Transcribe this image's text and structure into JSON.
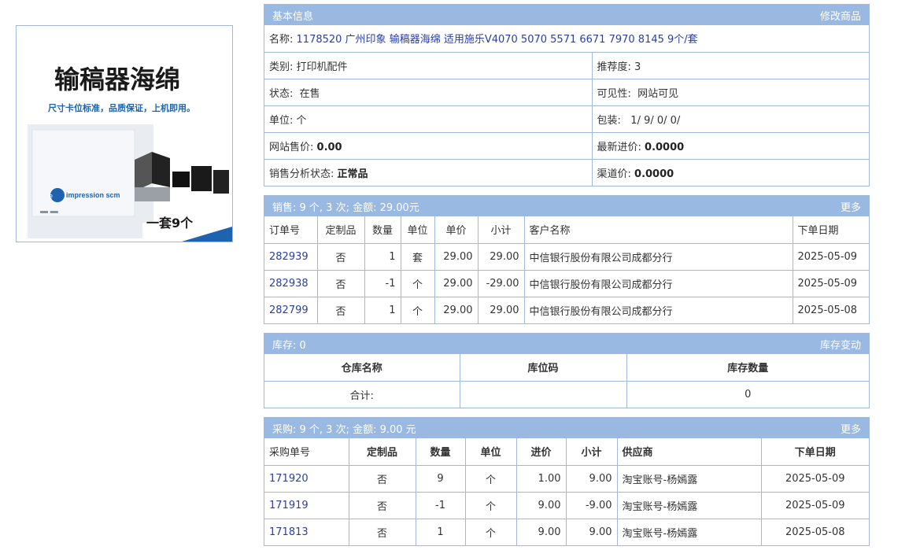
{
  "image": {
    "title": "输稿器海绵",
    "subtitle": "尺寸卡位标准，品质保证，上机即用。",
    "brand": "impression scm",
    "footer": "一套9个"
  },
  "basic": {
    "header": "基本信息",
    "action": "修改商品",
    "name_label": "名称:",
    "name_value": "1178520 广州印象 输稿器海绵 适用施乐V4070 5070 5571 6671 7970 8145 9个/套",
    "category_label": "类别:",
    "category_value": "打印机配件",
    "recommend_label": "推荐度:",
    "recommend_value": "3",
    "status_label": "状态:",
    "status_value": "在售",
    "visibility_label": "可见性:",
    "visibility_value": "网站可见",
    "unit_label": "单位:",
    "unit_value": "个",
    "pack_label": "包装:",
    "pack_value": "1/ 9/ 0/ 0/",
    "web_price_label": "网站售价:",
    "web_price_value": "0.00",
    "latest_cost_label": "最新进价:",
    "latest_cost_value": "0.0000",
    "analysis_label": "销售分析状态:",
    "analysis_value": "正常品",
    "channel_label": "渠道价:",
    "channel_value": "0.0000"
  },
  "sales": {
    "header": "销售: 9 个, 3 次; 金额: 29.00元",
    "more": "更多",
    "columns": [
      "订单号",
      "定制品",
      "数量",
      "单位",
      "单价",
      "小计",
      "客户名称",
      "下单日期"
    ],
    "rows": [
      {
        "id": "282939",
        "custom": "否",
        "qty": "1",
        "unit": "套",
        "price": "29.00",
        "subtotal": "29.00",
        "customer": "中信银行股份有限公司成都分行",
        "date": "2025-05-09"
      },
      {
        "id": "282938",
        "custom": "否",
        "qty": "-1",
        "unit": "个",
        "price": "29.00",
        "subtotal": "-29.00",
        "customer": "中信银行股份有限公司成都分行",
        "date": "2025-05-09"
      },
      {
        "id": "282799",
        "custom": "否",
        "qty": "1",
        "unit": "个",
        "price": "29.00",
        "subtotal": "29.00",
        "customer": "中信银行股份有限公司成都分行",
        "date": "2025-05-08"
      }
    ]
  },
  "stock": {
    "header": "库存: 0",
    "action": "库存变动",
    "columns": [
      "仓库名称",
      "库位码",
      "库存数量"
    ],
    "total_label": "合计:",
    "total_code": "",
    "total_qty": "0"
  },
  "purchase": {
    "header": "采购: 9 个, 3 次; 金额: 9.00 元",
    "more": "更多",
    "columns": [
      "采购单号",
      "定制品",
      "数量",
      "单位",
      "进价",
      "小计",
      "供应商",
      "下单日期"
    ],
    "rows": [
      {
        "id": "171920",
        "custom": "否",
        "qty": "9",
        "unit": "个",
        "price": "1.00",
        "subtotal": "9.00",
        "supplier": "淘宝账号-杨嫣露",
        "date": "2025-05-09"
      },
      {
        "id": "171919",
        "custom": "否",
        "qty": "-1",
        "unit": "个",
        "price": "9.00",
        "subtotal": "-9.00",
        "supplier": "淘宝账号-杨嫣露",
        "date": "2025-05-09"
      },
      {
        "id": "171813",
        "custom": "否",
        "qty": "1",
        "unit": "个",
        "price": "9.00",
        "subtotal": "9.00",
        "supplier": "淘宝账号-杨嫣露",
        "date": "2025-05-08"
      }
    ]
  }
}
